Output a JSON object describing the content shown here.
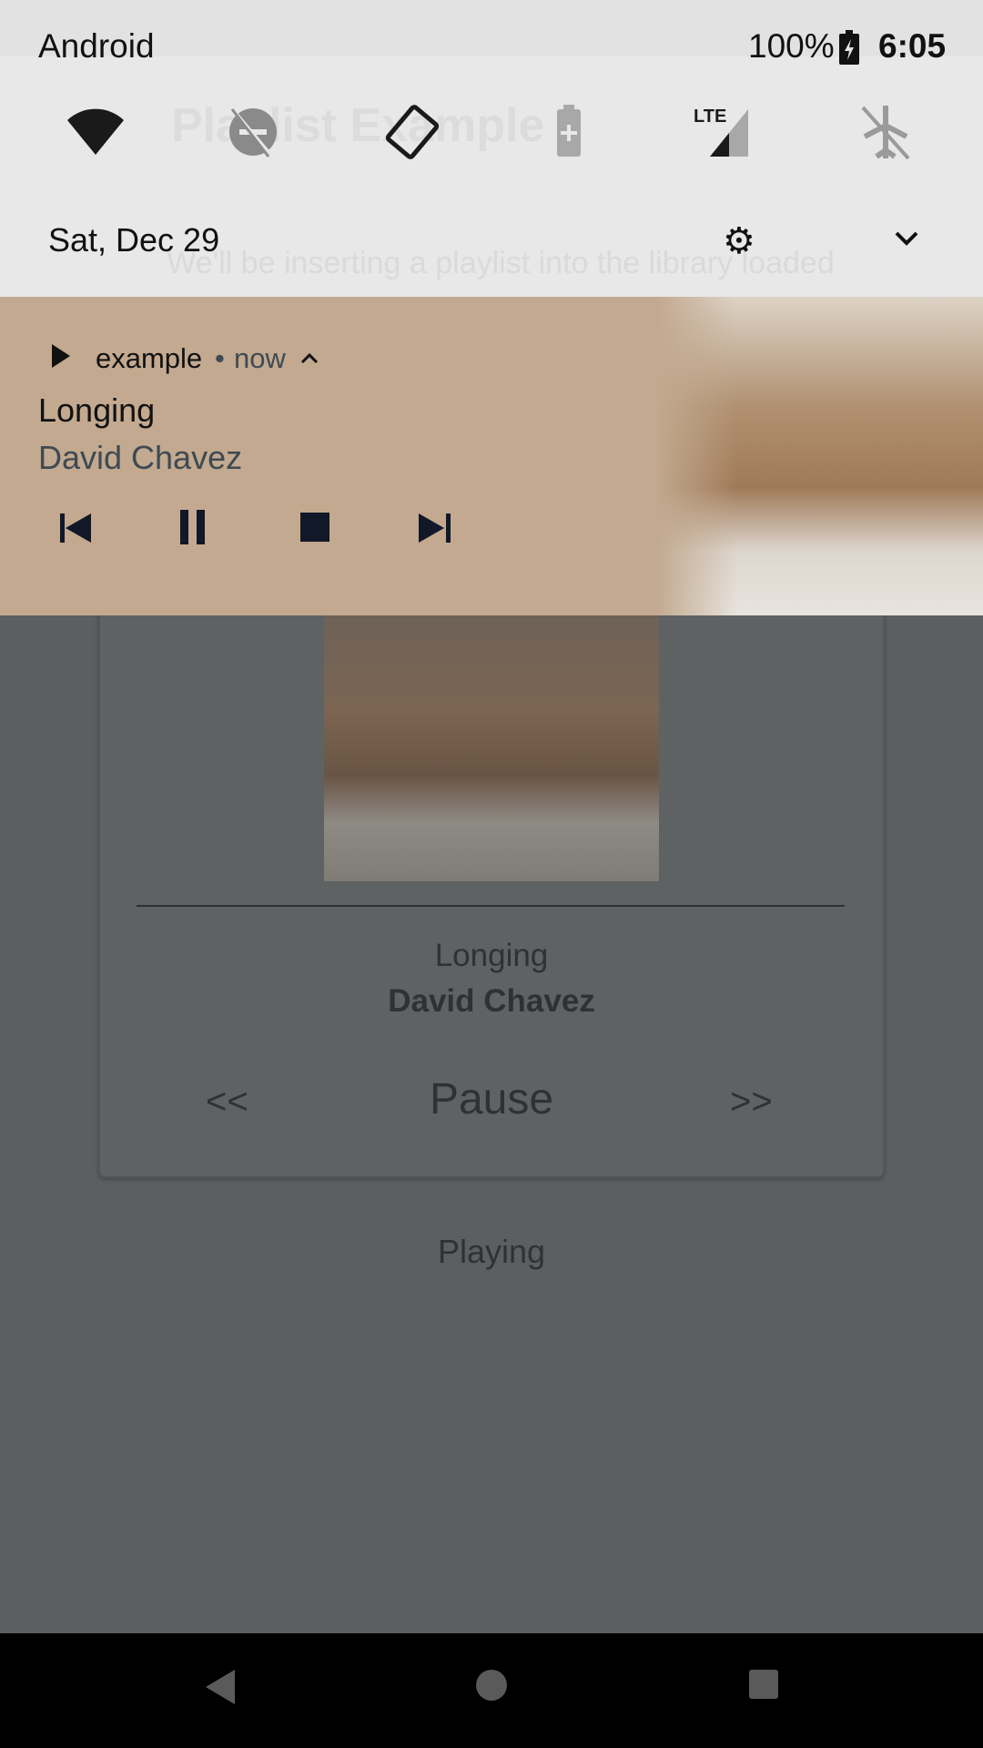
{
  "status_bar": {
    "carrier": "Android",
    "battery": "100%",
    "time": "6:05"
  },
  "quick_settings": {
    "icons": [
      "wifi-icon",
      "do-not-disturb-off-icon",
      "auto-rotate-icon",
      "battery-saver-icon",
      "lte-signal-icon",
      "airplane-mode-off-icon"
    ],
    "date": "Sat, Dec 29"
  },
  "background_app": {
    "title": "Playlist Example",
    "intro": "We'll be inserting a playlist into the library loaded",
    "song": "Longing",
    "artist": "David Chavez",
    "prev_label": "<<",
    "pause_label": "Pause",
    "next_label": ">>",
    "state": "Playing"
  },
  "notification": {
    "app": "example",
    "separator": "•",
    "time": "now",
    "title": "Longing",
    "artist": "David Chavez",
    "actions": [
      "skip-previous",
      "pause",
      "stop",
      "skip-next"
    ],
    "bg_color": "#c2a98f"
  }
}
